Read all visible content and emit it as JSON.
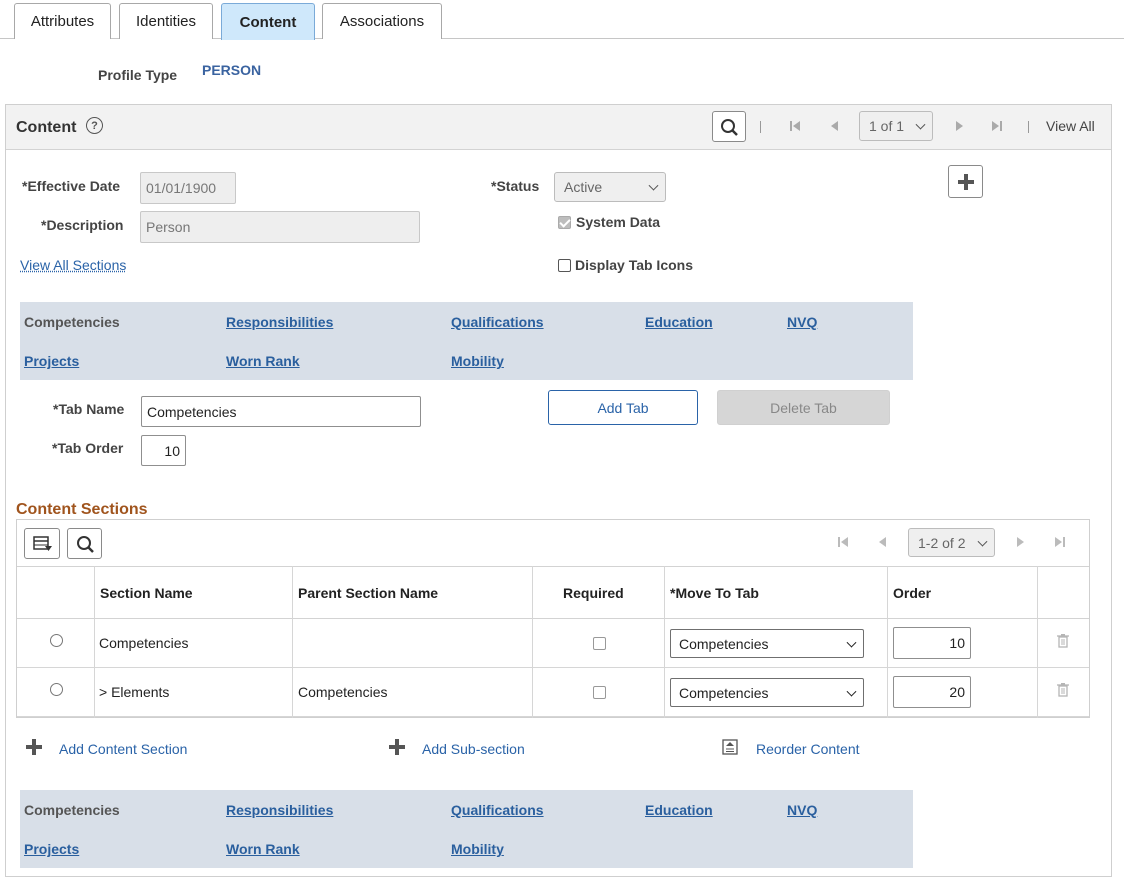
{
  "tabs": [
    {
      "label": "Attributes",
      "active": false
    },
    {
      "label": "Identities",
      "active": false
    },
    {
      "label": "Content",
      "active": true
    },
    {
      "label": "Associations",
      "active": false
    }
  ],
  "profile": {
    "label": "Profile Type",
    "value": "PERSON"
  },
  "content": {
    "title": "Content",
    "pager": {
      "range": "1 of 1",
      "view_all": "View All"
    },
    "effective_date": {
      "label": "*Effective Date",
      "value": "01/01/1900"
    },
    "description": {
      "label": "*Description",
      "value": "Person"
    },
    "status": {
      "label": "*Status",
      "value": "Active"
    },
    "system_data": {
      "label": "System Data",
      "checked": true
    },
    "display_tab_icons": {
      "label": "Display Tab Icons",
      "checked": false
    },
    "view_all_sections": "View All Sections"
  },
  "tab_strip": [
    "Competencies",
    "Responsibilities",
    "Qualifications",
    "Education",
    "NVQ",
    "Projects",
    "Worn Rank",
    "Mobility"
  ],
  "tab_form": {
    "tab_name_label": "*Tab Name",
    "tab_name_value": "Competencies",
    "tab_order_label": "*Tab Order",
    "tab_order_value": "10",
    "add_tab": "Add Tab",
    "delete_tab": "Delete Tab"
  },
  "content_sections": {
    "title": "Content Sections",
    "pager": "1-2 of 2",
    "columns": [
      "Section Name",
      "Parent Section Name",
      "Required",
      "*Move To Tab",
      "Order"
    ],
    "rows": [
      {
        "section": "Competencies",
        "parent": "",
        "required": false,
        "move_to_tab": "Competencies",
        "order": "10"
      },
      {
        "section": "> Elements",
        "parent": "Competencies",
        "required": false,
        "move_to_tab": "Competencies",
        "order": "20"
      }
    ]
  },
  "actions": {
    "add_content_section": "Add Content Section",
    "add_sub_section": "Add Sub-section",
    "reorder_content": "Reorder Content"
  },
  "colors": {
    "accent": "#2a63a8",
    "section_title": "#a0541d",
    "tab_active": "#cfe8fb",
    "strip_bg": "#d8dfe8"
  }
}
